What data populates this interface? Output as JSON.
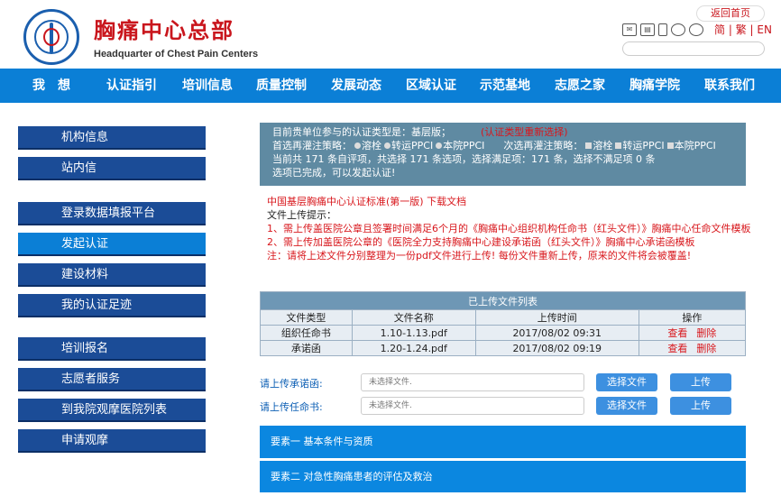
{
  "header": {
    "title": "胸痛中心总部",
    "subtitle": "Headquarter of Chest Pain Centers",
    "back_home": "返回首页",
    "langs": [
      "简",
      "繁",
      "EN"
    ],
    "logo_text": "Headquarter of Chest Pain Centers"
  },
  "nav": [
    "我　想",
    "认证指引",
    "培训信息",
    "质量控制",
    "发展动态",
    "区域认证",
    "示范基地",
    "志愿之家",
    "胸痛学院",
    "联系我们"
  ],
  "sidebar": {
    "group1": [
      "机构信息",
      "站内信"
    ],
    "group2": [
      "登录数据填报平台",
      "发起认证",
      "建设材料",
      "我的认证足迹"
    ],
    "group3": [
      "培训报名",
      "志愿者服务",
      "到我院观摩医院列表",
      "申请观摩"
    ]
  },
  "status": {
    "line1_prefix": "目前贵单位参与的认证类型是：基层版；",
    "line1_link": "(认证类型重新选择)",
    "line2_label1": "首选再灌注策略：",
    "opt1": "溶栓",
    "opt2": "转运PPCI",
    "opt3": "本院PPCI",
    "line2_label2": "次选再灌注策略：",
    "opt4": "溶栓",
    "opt5": "转运PPCI",
    "opt6": "本院PPCI",
    "line3": "当前共 171 条自评项，共选择 171 条选项，选择满足项：171 条，选择不满足项 0 条",
    "line4": "选项已完成，可以发起认证!"
  },
  "info": {
    "std_title": "中国基层胸痛中心认证标准(第一版)",
    "download": "下载文档",
    "hint_title": "文件上传提示：",
    "hint1_text": "1、需上传盖医院公章且签署时间满足6个月的《胸痛中心组织机构任命书（红头文件）》",
    "hint1_link": "胸痛中心任命文件模板",
    "hint2_text": "2、需上传加盖医院公章的《医院全力支持胸痛中心建设承诺函（红头文件）》",
    "hint2_link": "胸痛中心承诺函模板",
    "note": "注：请将上述文件分别整理为一份pdf文件进行上传! 每份文件重新上传，原来的文件将会被覆盖!"
  },
  "table": {
    "caption": "已上传文件列表",
    "headers": [
      "文件类型",
      "文件名称",
      "上传时间",
      "操作"
    ],
    "rows": [
      {
        "type": "组织任命书",
        "name": "1.10-1.13.pdf",
        "time": "2017/08/02 09:31",
        "view": "查看",
        "del": "删除"
      },
      {
        "type": "承诺函",
        "name": "1.20-1.24.pdf",
        "time": "2017/08/02 09:19",
        "view": "查看",
        "del": "删除"
      }
    ]
  },
  "upload": {
    "promise_label": "请上传承诺函:",
    "appoint_label": "请上传任命书:",
    "placeholder": "未选择文件.",
    "pick": "选择文件",
    "upload": "上传"
  },
  "elements": [
    "要素一 基本条件与资质",
    "要素二 对急性胸痛患者的评估及救治"
  ],
  "colors": {
    "nav": "#0b7fd6",
    "sidebar": "#1b4c97",
    "accent": "#c9161d"
  }
}
